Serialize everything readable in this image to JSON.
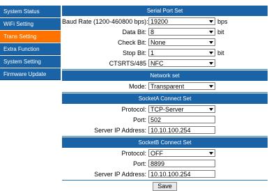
{
  "sidebar": {
    "items": [
      {
        "label": "System Status"
      },
      {
        "label": "WiFi Setting"
      },
      {
        "label": "Trans Setting"
      },
      {
        "label": "Extra Function"
      },
      {
        "label": "System Setting"
      },
      {
        "label": "Firmware Update"
      }
    ],
    "active_index": 2
  },
  "colors": {
    "nav_bg": "#1a63a6",
    "nav_active": "#ff7400",
    "header_bg": "#1a63a6"
  },
  "serial": {
    "title": "Serial Port Set",
    "baud_label": "Baud Rate (1200-460800 bps):",
    "baud_value": "19200",
    "baud_unit": "bps",
    "databit_label": "Data Bit:",
    "databit_value": "8",
    "databit_unit": "bit",
    "check_label": "Check Bit:",
    "check_value": "None",
    "stop_label": "Stop Bit:",
    "stop_value": "1",
    "stop_unit": "bit",
    "cts_label": "CTSRTS/485",
    "cts_value": "NFC"
  },
  "network": {
    "title": "Network set",
    "mode_label": "Mode:",
    "mode_value": "Transparent"
  },
  "socketA": {
    "title": "SocketA Connect Set",
    "protocol_label": "Protocol:",
    "protocol_value": "TCP-Server",
    "port_label": "Port:",
    "port_value": "502",
    "ip_label": "Server IP Address:",
    "ip_value": "10.10.100.254"
  },
  "socketB": {
    "title": "SocketB Connect Set",
    "protocol_label": "Protocol:",
    "protocol_value": "OFF",
    "port_label": "Port:",
    "port_value": "8899",
    "ip_label": "Server IP Address:",
    "ip_value": "10.10.100.254"
  },
  "save_label": "Save"
}
